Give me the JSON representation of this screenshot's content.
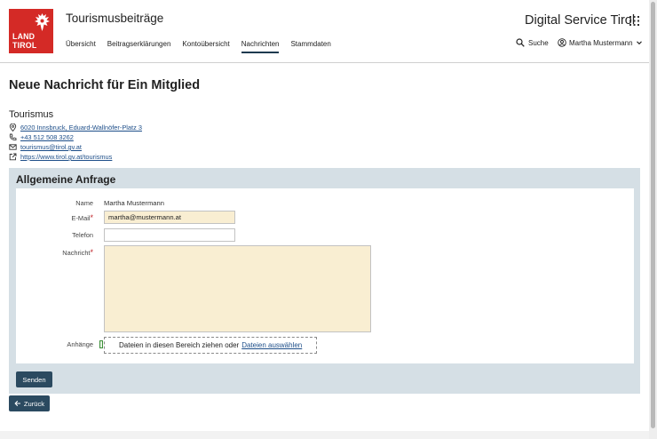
{
  "header": {
    "logo_line1": "LAND",
    "logo_line2": "TIROL",
    "app_title": "Tourismusbeiträge",
    "brand": "Digital Service Tirol",
    "nav": [
      {
        "label": "Übersicht"
      },
      {
        "label": "Beitragserklärungen"
      },
      {
        "label": "Kontoübersicht"
      },
      {
        "label": "Nachrichten",
        "active": true
      },
      {
        "label": "Stammdaten"
      }
    ],
    "search_label": "Suche",
    "user_name": "Martha Mustermann"
  },
  "page": {
    "title": "Neue Nachricht für Ein Mitglied"
  },
  "organization": {
    "name": "Tourismus",
    "address": "6020 Innsbruck, Eduard-Wallnöfer-Platz 3",
    "phone": "+43 512 508 3262",
    "email": "tourismus@tirol.gv.at",
    "website": "https://www.tirol.gv.at/tourismus"
  },
  "form": {
    "section_title": "Allgemeine Anfrage",
    "name_label": "Name",
    "name_value": "Martha Mustermann",
    "email_label": "E-Mail",
    "email_value": "martha@mustermann.at",
    "phone_label": "Telefon",
    "phone_value": "",
    "message_label": "Nachricht",
    "message_value": "",
    "attachments_label": "Anhänge",
    "dropzone_text": "Dateien in diesen Bereich ziehen oder",
    "dropzone_link": "Dateien auswählen",
    "required_marker": "*",
    "send_label": "Senden"
  },
  "back_label": "Zurück",
  "colors": {
    "brand_red": "#d42a26",
    "primary": "#2b4a60",
    "panel_bg": "#d5dfe5",
    "field_filled": "#f9eed2",
    "link": "#1d4e89"
  }
}
